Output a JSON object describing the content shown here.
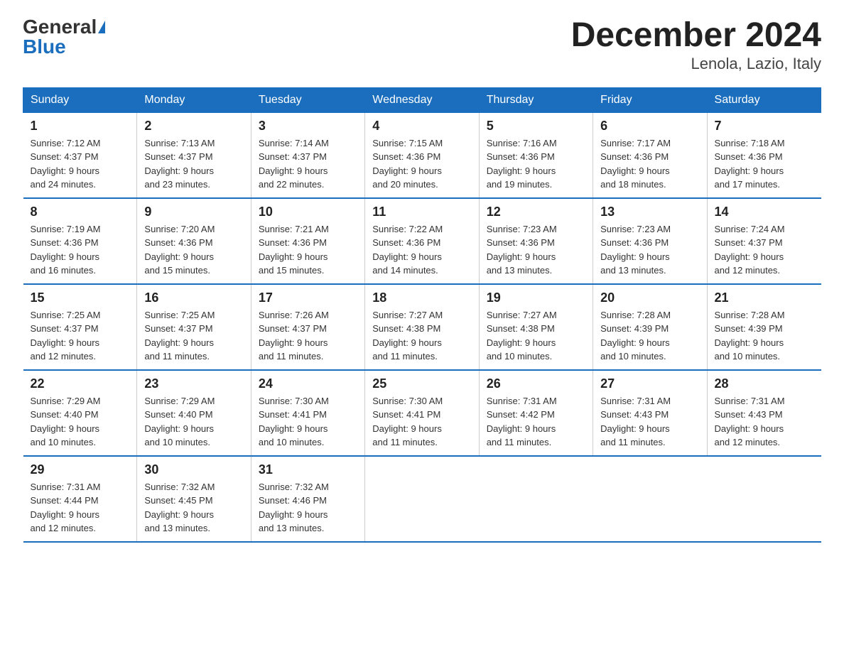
{
  "logo": {
    "general": "General",
    "blue": "Blue"
  },
  "title": "December 2024",
  "subtitle": "Lenola, Lazio, Italy",
  "days_header": [
    "Sunday",
    "Monday",
    "Tuesday",
    "Wednesday",
    "Thursday",
    "Friday",
    "Saturday"
  ],
  "weeks": [
    [
      {
        "day": "1",
        "sunrise": "7:12 AM",
        "sunset": "4:37 PM",
        "daylight": "9 hours and 24 minutes."
      },
      {
        "day": "2",
        "sunrise": "7:13 AM",
        "sunset": "4:37 PM",
        "daylight": "9 hours and 23 minutes."
      },
      {
        "day": "3",
        "sunrise": "7:14 AM",
        "sunset": "4:37 PM",
        "daylight": "9 hours and 22 minutes."
      },
      {
        "day": "4",
        "sunrise": "7:15 AM",
        "sunset": "4:36 PM",
        "daylight": "9 hours and 20 minutes."
      },
      {
        "day": "5",
        "sunrise": "7:16 AM",
        "sunset": "4:36 PM",
        "daylight": "9 hours and 19 minutes."
      },
      {
        "day": "6",
        "sunrise": "7:17 AM",
        "sunset": "4:36 PM",
        "daylight": "9 hours and 18 minutes."
      },
      {
        "day": "7",
        "sunrise": "7:18 AM",
        "sunset": "4:36 PM",
        "daylight": "9 hours and 17 minutes."
      }
    ],
    [
      {
        "day": "8",
        "sunrise": "7:19 AM",
        "sunset": "4:36 PM",
        "daylight": "9 hours and 16 minutes."
      },
      {
        "day": "9",
        "sunrise": "7:20 AM",
        "sunset": "4:36 PM",
        "daylight": "9 hours and 15 minutes."
      },
      {
        "day": "10",
        "sunrise": "7:21 AM",
        "sunset": "4:36 PM",
        "daylight": "9 hours and 15 minutes."
      },
      {
        "day": "11",
        "sunrise": "7:22 AM",
        "sunset": "4:36 PM",
        "daylight": "9 hours and 14 minutes."
      },
      {
        "day": "12",
        "sunrise": "7:23 AM",
        "sunset": "4:36 PM",
        "daylight": "9 hours and 13 minutes."
      },
      {
        "day": "13",
        "sunrise": "7:23 AM",
        "sunset": "4:36 PM",
        "daylight": "9 hours and 13 minutes."
      },
      {
        "day": "14",
        "sunrise": "7:24 AM",
        "sunset": "4:37 PM",
        "daylight": "9 hours and 12 minutes."
      }
    ],
    [
      {
        "day": "15",
        "sunrise": "7:25 AM",
        "sunset": "4:37 PM",
        "daylight": "9 hours and 12 minutes."
      },
      {
        "day": "16",
        "sunrise": "7:25 AM",
        "sunset": "4:37 PM",
        "daylight": "9 hours and 11 minutes."
      },
      {
        "day": "17",
        "sunrise": "7:26 AM",
        "sunset": "4:37 PM",
        "daylight": "9 hours and 11 minutes."
      },
      {
        "day": "18",
        "sunrise": "7:27 AM",
        "sunset": "4:38 PM",
        "daylight": "9 hours and 11 minutes."
      },
      {
        "day": "19",
        "sunrise": "7:27 AM",
        "sunset": "4:38 PM",
        "daylight": "9 hours and 10 minutes."
      },
      {
        "day": "20",
        "sunrise": "7:28 AM",
        "sunset": "4:39 PM",
        "daylight": "9 hours and 10 minutes."
      },
      {
        "day": "21",
        "sunrise": "7:28 AM",
        "sunset": "4:39 PM",
        "daylight": "9 hours and 10 minutes."
      }
    ],
    [
      {
        "day": "22",
        "sunrise": "7:29 AM",
        "sunset": "4:40 PM",
        "daylight": "9 hours and 10 minutes."
      },
      {
        "day": "23",
        "sunrise": "7:29 AM",
        "sunset": "4:40 PM",
        "daylight": "9 hours and 10 minutes."
      },
      {
        "day": "24",
        "sunrise": "7:30 AM",
        "sunset": "4:41 PM",
        "daylight": "9 hours and 10 minutes."
      },
      {
        "day": "25",
        "sunrise": "7:30 AM",
        "sunset": "4:41 PM",
        "daylight": "9 hours and 11 minutes."
      },
      {
        "day": "26",
        "sunrise": "7:31 AM",
        "sunset": "4:42 PM",
        "daylight": "9 hours and 11 minutes."
      },
      {
        "day": "27",
        "sunrise": "7:31 AM",
        "sunset": "4:43 PM",
        "daylight": "9 hours and 11 minutes."
      },
      {
        "day": "28",
        "sunrise": "7:31 AM",
        "sunset": "4:43 PM",
        "daylight": "9 hours and 12 minutes."
      }
    ],
    [
      {
        "day": "29",
        "sunrise": "7:31 AM",
        "sunset": "4:44 PM",
        "daylight": "9 hours and 12 minutes."
      },
      {
        "day": "30",
        "sunrise": "7:32 AM",
        "sunset": "4:45 PM",
        "daylight": "9 hours and 13 minutes."
      },
      {
        "day": "31",
        "sunrise": "7:32 AM",
        "sunset": "4:46 PM",
        "daylight": "9 hours and 13 minutes."
      },
      null,
      null,
      null,
      null
    ]
  ],
  "labels": {
    "sunrise": "Sunrise:",
    "sunset": "Sunset:",
    "daylight": "Daylight:"
  }
}
